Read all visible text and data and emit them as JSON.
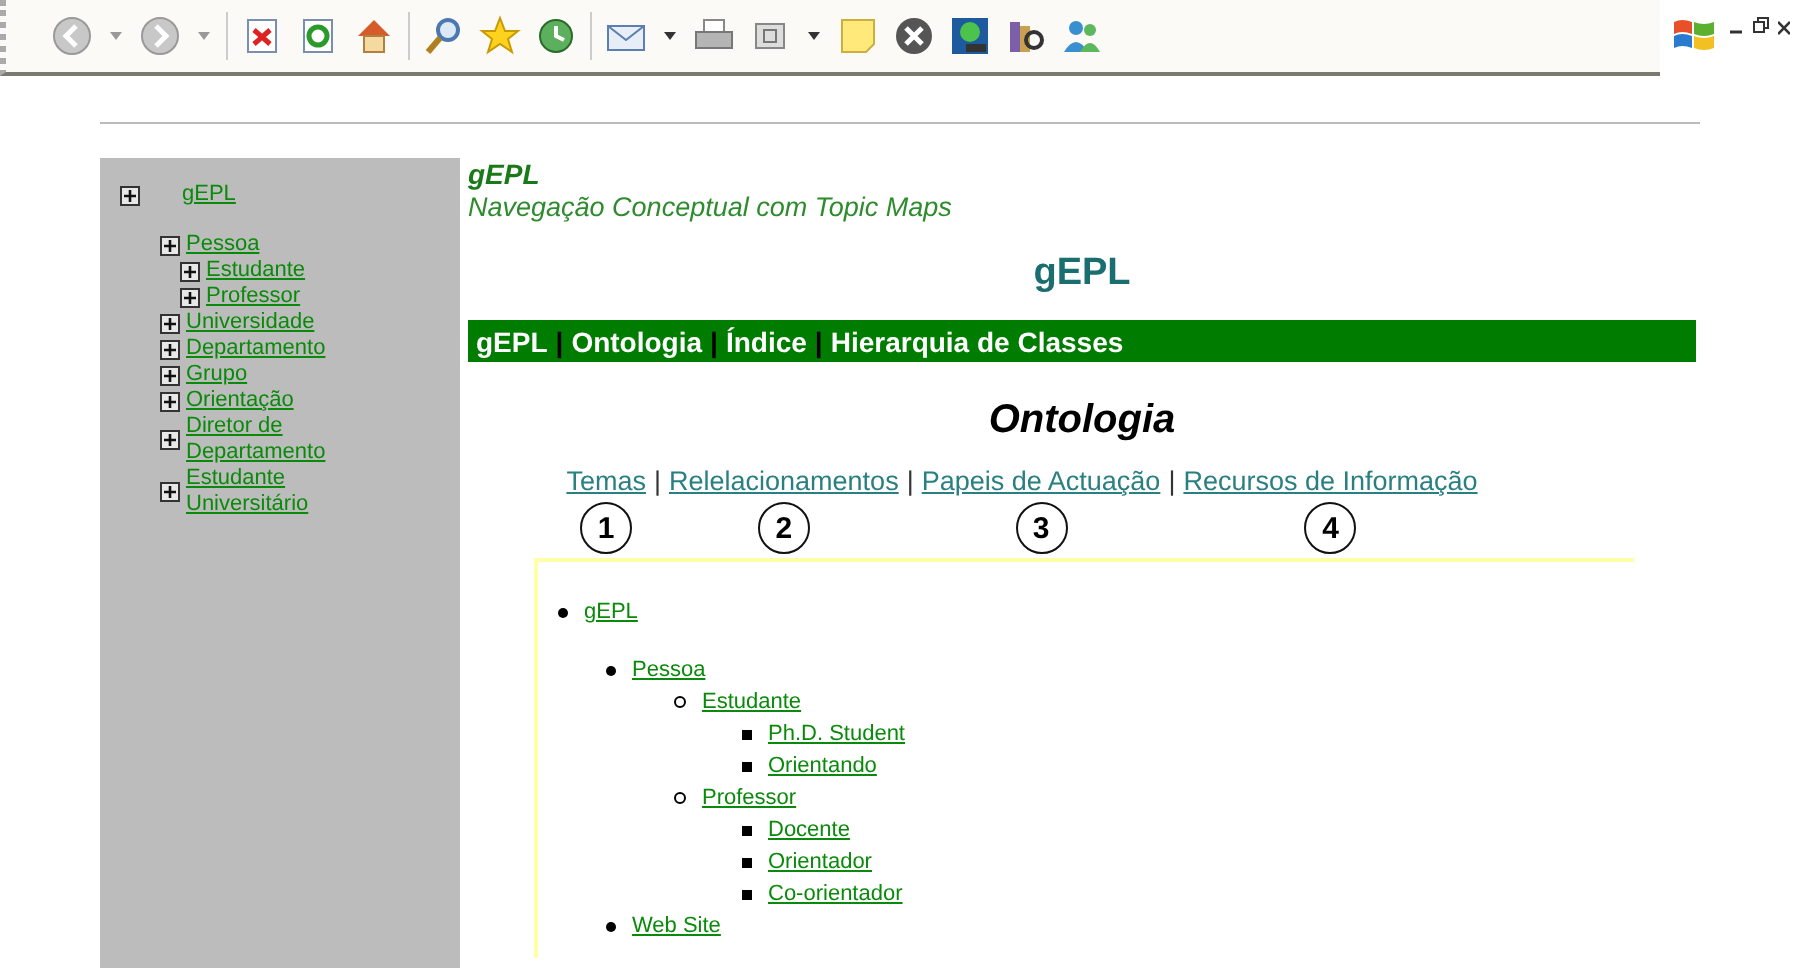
{
  "sidebar": {
    "items": [
      {
        "label": "gEPL",
        "children": [
          {
            "label": "Pessoa",
            "children": [
              {
                "label": "Estudante"
              },
              {
                "label": "Professor"
              }
            ]
          },
          {
            "label": "Universidade"
          },
          {
            "label": "Departamento"
          },
          {
            "label": "Grupo"
          },
          {
            "label": "Orientação"
          },
          {
            "label": "Diretor de Departamento"
          },
          {
            "label": "Estudante Universitário"
          }
        ]
      }
    ]
  },
  "header": {
    "title": "gEPL",
    "subtitle": "Navegação Conceptual com Topic Maps",
    "page_title": "gEPL"
  },
  "nav_bar": [
    {
      "label": "gEPL"
    },
    {
      "label": "Ontologia",
      "separator_before": "|"
    },
    {
      "label": "Índice",
      "separator_before": "|"
    },
    {
      "label": "Hierarquia de Classes",
      "separator_before": "|"
    }
  ],
  "section_title": "Ontologia",
  "section_links": [
    {
      "label": "Temas",
      "number": "1"
    },
    {
      "label": "Relelacionamentos",
      "number": "2",
      "separator_before": "|"
    },
    {
      "label": "Papeis de Actuação",
      "number": "3",
      "separator_before": "|"
    },
    {
      "label": "Recursos de Informação",
      "number": "4",
      "separator_before": "|"
    }
  ],
  "tree": [
    {
      "label": "gEPL",
      "children": [
        {
          "label": "Pessoa",
          "children": [
            {
              "label": "Estudante",
              "children": [
                {
                  "label": "Ph.D. Student"
                },
                {
                  "label": "Orientando"
                }
              ]
            },
            {
              "label": "Professor",
              "children": [
                {
                  "label": "Docente"
                },
                {
                  "label": "Orientador"
                },
                {
                  "label": "Co-orientador"
                }
              ]
            }
          ]
        },
        {
          "label": "Web Site"
        }
      ]
    }
  ]
}
